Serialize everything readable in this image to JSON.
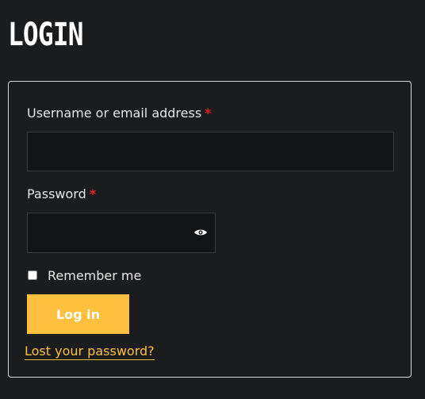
{
  "page": {
    "title": "LOGIN"
  },
  "form": {
    "username_label": "Username or email address",
    "username_required": "*",
    "username_value": "",
    "password_label": "Password",
    "password_required": "*",
    "password_value": "",
    "password_toggle_icon": "eye-icon",
    "remember_label": "Remember me",
    "remember_checked": false,
    "login_button_label": "Log in",
    "lost_password_label": "Lost your password?"
  },
  "colors": {
    "background": "#1b1c1e",
    "input_background": "#131416",
    "accent": "#ffbf3f",
    "required": "#e02020",
    "text": "#e6e6e6"
  }
}
